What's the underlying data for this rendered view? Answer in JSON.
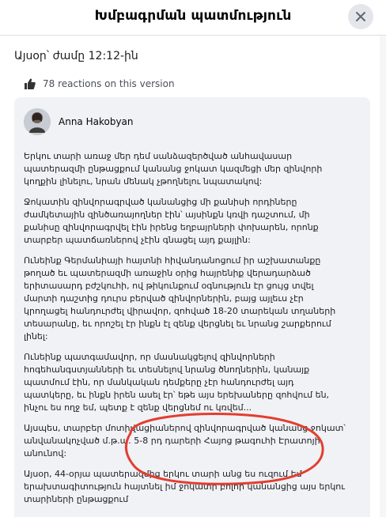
{
  "header": {
    "title": "Խմբագրման պատմություն"
  },
  "history": {
    "time_label": "Այսօր՝ ժամը 12:12-ին",
    "reactions_label": "78 reactions on this version"
  },
  "post": {
    "author_name": "Anna Hakobyan",
    "paragraphs": [
      "Երկու տարի առաջ մեր դեմ սանձազերծված անհավասար պատերազմի ընթացքում կանանց ջոկատ կազմեցի մեր զինվորի կողքին լինելու, նրան մենակ չթողնելու նպատակով:",
      "Ջոկատին զինվորագրված կանանցից մի քանիսի որդիները ժամկետային զինծառայողներ էին՝ այսինքն կռվի դաշտում, մի քանիսը զինվորագրվել էին իրենց եղբայրների փոխարեն, որոնք տարբեր պատճառներով չէին գնացել այդ քայլին:",
      "Ունեինք Գերմանիայի հայտնի հիվանդանոցում իր աշխատանքը թողած եւ պատերազմի առաջին օրից հայրենիք վերադարձած երիտասարդ բժշկուհի, ով թիկունքում օգնություն էր ցույց տվել մարտի դաշտից դուրս բերված զինվորներին, բայց այլեւս չէր կրողացել հանդուրժել վիրավոր, զոհված 18-20 տարեկան տղաների տեսարանը, եւ որոշել էր ինքն էլ զենք վերցնել եւ նրանց շարքերում լինել:",
      "Ունեինք պատգամավոր, որ մասնակցելով զինվորների հոգեհանգստյանների եւ տեսնելով նրանց ծնողներին, կանայք պատմում էին, որ մանկական դեմքերը չէր հանդուրժել այդ պատկերը, եւ ինքն իրեն ասել էր՝ եթե այս երեխաները զոհվում են, ինչու ես ողջ եմ, պետք է զենք վերցնեմ ու կռվեմ...",
      "Այսպես, տարբեր մոտիվացիաներով զինվորագրված կանանց ջոկատ՝ անվանակոչված մ.թ.ա. 5-8 րդ դարերի Հայոց թագուհի Էրատոյի անունով:",
      "Այսօր, 44-օրյա պատերազմից երկու տարի անց ես ուզում եմ երախտագիտություն հայտնել իմ ջոկատի բոլոր կանանցից այս երկու տարիների ընթացքում"
    ]
  }
}
